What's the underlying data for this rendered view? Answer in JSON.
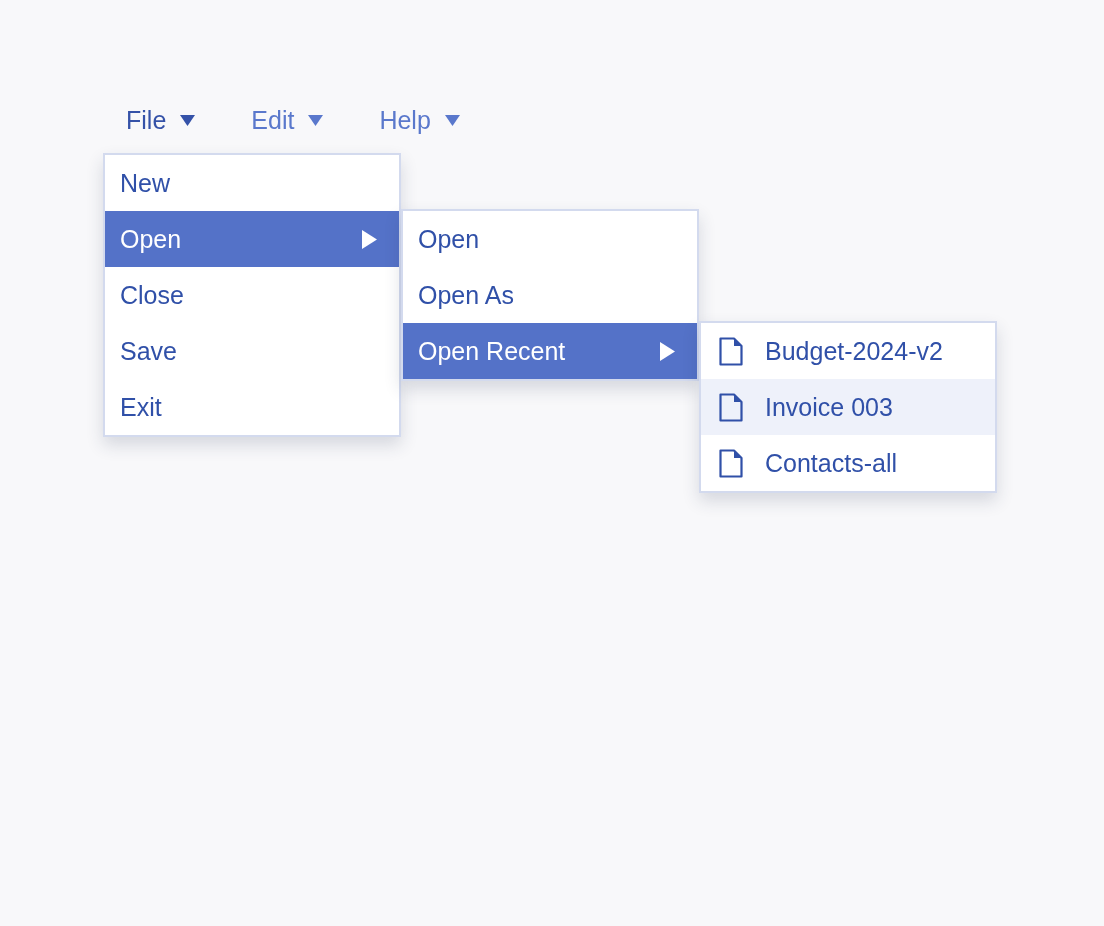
{
  "menubar": [
    {
      "label": "File",
      "selected": true,
      "items": [
        {
          "label": "New",
          "kind": "plain",
          "selected": false
        },
        {
          "label": "Open",
          "kind": "submenu",
          "selected": true,
          "items": [
            {
              "label": "Open",
              "kind": "plain",
              "selected": false
            },
            {
              "label": "Open As",
              "kind": "plain",
              "selected": false
            },
            {
              "label": "Open Recent",
              "kind": "submenu",
              "selected": true,
              "items": [
                {
                  "label": "Budget-2024-v2",
                  "kind": "file",
                  "hovered": false
                },
                {
                  "label": "Invoice 003",
                  "kind": "file",
                  "hovered": true
                },
                {
                  "label": "Contacts-all",
                  "kind": "file",
                  "hovered": false
                }
              ]
            }
          ]
        },
        {
          "label": "Close",
          "kind": "plain",
          "selected": false
        },
        {
          "label": "Save",
          "kind": "plain",
          "selected": false
        },
        {
          "label": "Exit",
          "kind": "plain",
          "selected": false
        }
      ]
    },
    {
      "label": "Edit",
      "selected": false
    },
    {
      "label": "Help",
      "selected": false
    }
  ]
}
